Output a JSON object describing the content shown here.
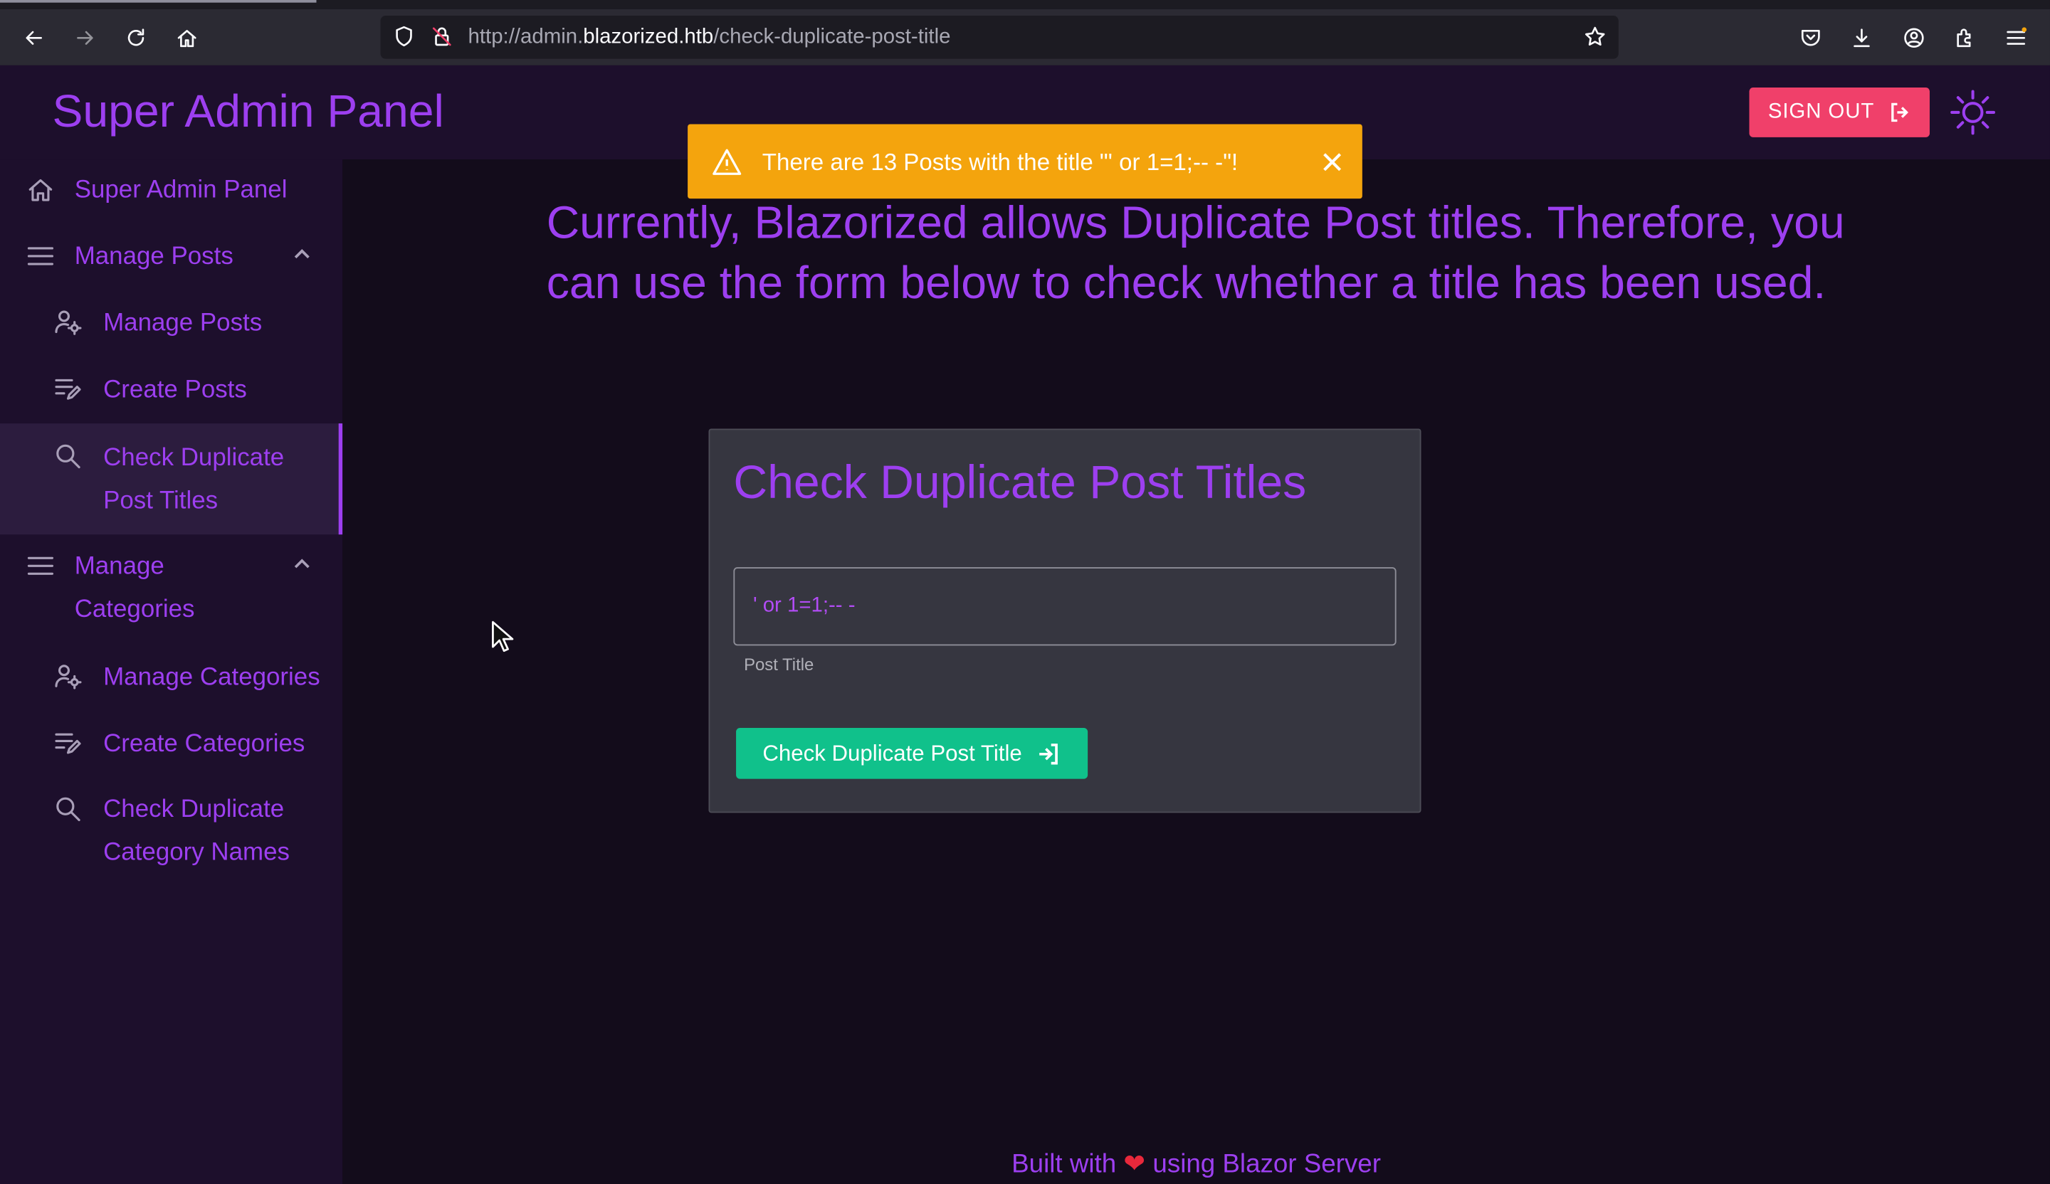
{
  "browser": {
    "url_prefix": "http://admin.",
    "url_host": "blazorized.htb",
    "url_path": "/check-duplicate-post-title"
  },
  "header": {
    "title": "Super Admin Panel",
    "signout_label": "SIGN OUT"
  },
  "sidebar": {
    "items": [
      {
        "label": "Super Admin Panel",
        "icon": "home-icon"
      },
      {
        "label": "Manage Posts",
        "icon": "menu-icon",
        "expandable": true
      },
      {
        "label": "Manage Posts",
        "icon": "user-settings-icon"
      },
      {
        "label": "Create Posts",
        "icon": "edit-list-icon"
      },
      {
        "label": "Check Duplicate Post Titles",
        "icon": "search-icon",
        "active": true
      },
      {
        "label": "Manage Categories",
        "icon": "menu-icon",
        "expandable": true
      },
      {
        "label": "Manage Categories",
        "icon": "user-settings-icon"
      },
      {
        "label": "Create Categories",
        "icon": "edit-list-icon"
      },
      {
        "label": "Check Duplicate Category Names",
        "icon": "search-icon"
      }
    ]
  },
  "main": {
    "intro": "Currently, Blazorized allows Duplicate Post titles. Therefore, you can use the form below to check whether a title has been used.",
    "card_title": "Check Duplicate Post Titles",
    "input_value": "' or 1=1;-- -",
    "input_label": "Post Title",
    "button_label": "Check Duplicate Post Title"
  },
  "toast": {
    "message": "There are 13 Posts with the title \"' or 1=1;-- -\"!"
  },
  "footer": {
    "before": "Built with",
    "heart": "❤",
    "after": "using Blazor Server"
  },
  "colors": {
    "accent": "#9d3ff0",
    "success": "#10c18b",
    "danger": "#f0406a",
    "warning": "#f4a40d"
  }
}
